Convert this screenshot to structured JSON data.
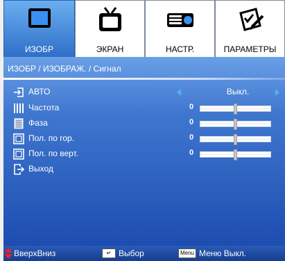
{
  "tabs": [
    {
      "label": "ИЗОБР",
      "icon": "display-icon",
      "active": true
    },
    {
      "label": "ЭКРАН",
      "icon": "tv-screen-icon",
      "active": false
    },
    {
      "label": "НАСТР.",
      "icon": "projector-icon",
      "active": false
    },
    {
      "label": "ПАРАМЕТРЫ",
      "icon": "checklist-pencil-icon",
      "active": false
    }
  ],
  "breadcrumb": "ИЗОБР / ИЗОБРАЖ. / Сигнал",
  "items": [
    {
      "label": "АВТО",
      "icon": "enter-icon",
      "value": "Выкл."
    },
    {
      "label": "Частота",
      "icon": "bars-icon",
      "value": "0",
      "level": 0.5
    },
    {
      "label": "Фаза",
      "icon": "phase-grid-icon",
      "value": "0",
      "level": 0.5
    },
    {
      "label": "Пол. по гор.",
      "icon": "frame-icon",
      "value": "0",
      "level": 0.5
    },
    {
      "label": "Пол. по верт.",
      "icon": "frame-icon",
      "value": "0",
      "level": 0.5
    },
    {
      "label": "Выход",
      "icon": "exit-icon"
    }
  ],
  "footer": {
    "nav_label": "ВверхВниз",
    "select_label": "Выбор",
    "menu_key": "Menu",
    "menu_label": "Меню Выкл."
  },
  "colors": {
    "accent": "#2f6fc8",
    "panel_top": "#6a9fe6",
    "panel_bottom": "#1d4db0",
    "arrow": "#5aaef5"
  }
}
